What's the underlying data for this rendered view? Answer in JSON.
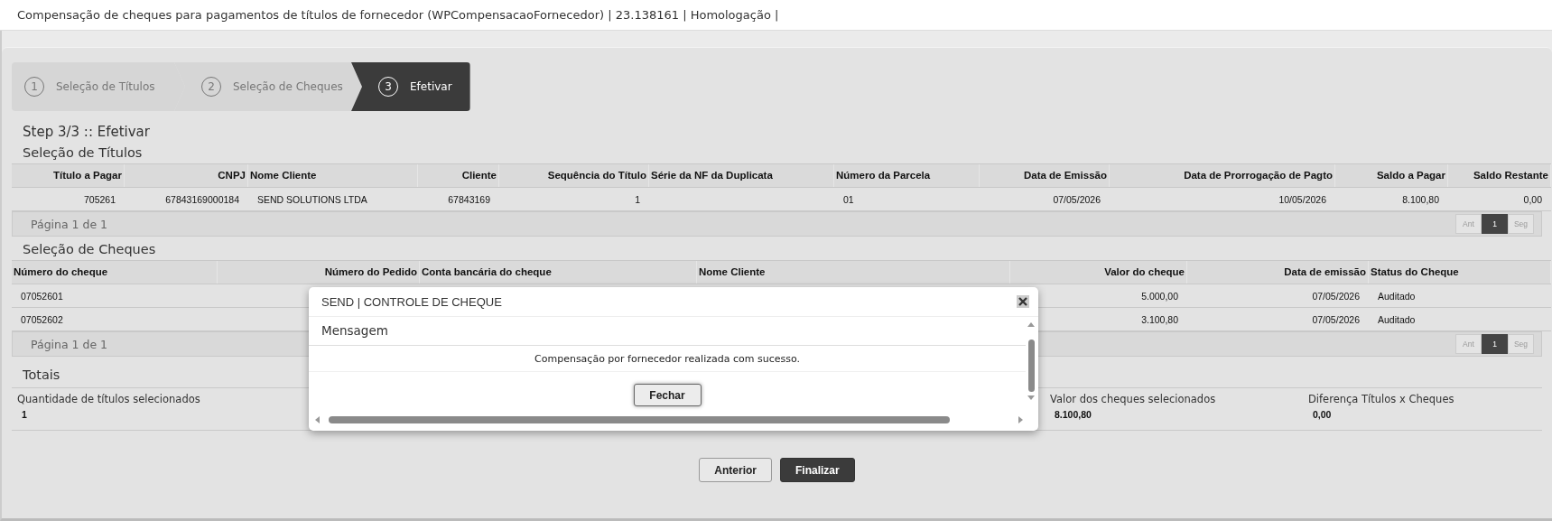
{
  "window": {
    "title": "Compensação de cheques para pagamentos de títulos de fornecedor (WPCompensacaoFornecedor) | 23.138161 | Homologação |"
  },
  "steps": [
    {
      "number": "1",
      "label": "Seleção de Títulos",
      "selected": false
    },
    {
      "number": "2",
      "label": "Seleção de Cheques",
      "selected": false
    },
    {
      "number": "3",
      "label": "Efetivar",
      "selected": true
    }
  ],
  "step_heading": "Step 3/3 :: Efetivar",
  "titulos": {
    "heading": "Seleção de Títulos",
    "columns": [
      "Título a Pagar",
      "CNPJ",
      "Nome Cliente",
      "Cliente",
      "Sequência do Título",
      "Série da NF da Duplicata",
      "Número da Parcela",
      "Data de Emissão",
      "Data de Prorrogação de Pagto",
      "Saldo a Pagar",
      "Saldo Restante"
    ],
    "rows": [
      [
        "705261",
        "67843169000184",
        "SEND SOLUTIONS LTDA",
        "67843169",
        "1",
        "",
        "01",
        "07/05/2026",
        "10/05/2026",
        "8.100,80",
        "0,00"
      ]
    ],
    "page_info": "Página 1 de 1",
    "pager": [
      {
        "label": "Ant",
        "selected": false
      },
      {
        "label": "1",
        "selected": true
      },
      {
        "label": "Seg",
        "selected": false
      }
    ]
  },
  "cheques": {
    "heading": "Seleção de Cheques",
    "columns": [
      "Número do cheque",
      "Número do Pedido",
      "Conta bancária do cheque",
      "Nome Cliente",
      "Valor do cheque",
      "Data de emissão",
      "Status do Cheque"
    ],
    "rows": [
      {
        "numero": "07052601",
        "valor": "5.000,00",
        "data": "07/05/2026",
        "status": "Auditado"
      },
      {
        "numero": "07052602",
        "valor": "3.100,80",
        "data": "07/05/2026",
        "status": "Auditado"
      }
    ],
    "page_info": "Página 1 de 1",
    "pager": [
      {
        "label": "Ant",
        "selected": false
      },
      {
        "label": "1",
        "selected": true
      },
      {
        "label": "Seg",
        "selected": false
      }
    ]
  },
  "totais": {
    "heading": "Totais",
    "items": [
      {
        "label": "Quantidade de títulos selecionados",
        "value": "1"
      },
      {
        "label": "Valor dos cheques selecionados",
        "value": "8.100,80"
      },
      {
        "label": "Diferença Títulos x Cheques",
        "value": "0,00"
      }
    ]
  },
  "buttons": [
    {
      "label": "Anterior",
      "kind": "secondary"
    },
    {
      "label": "Finalizar",
      "kind": "primary"
    }
  ],
  "dialog": {
    "title": "SEND | CONTROLE DE CHEQUE",
    "section": "Mensagem",
    "message": "Compensação por fornecedor realizada com sucesso.",
    "button": "Fechar"
  }
}
